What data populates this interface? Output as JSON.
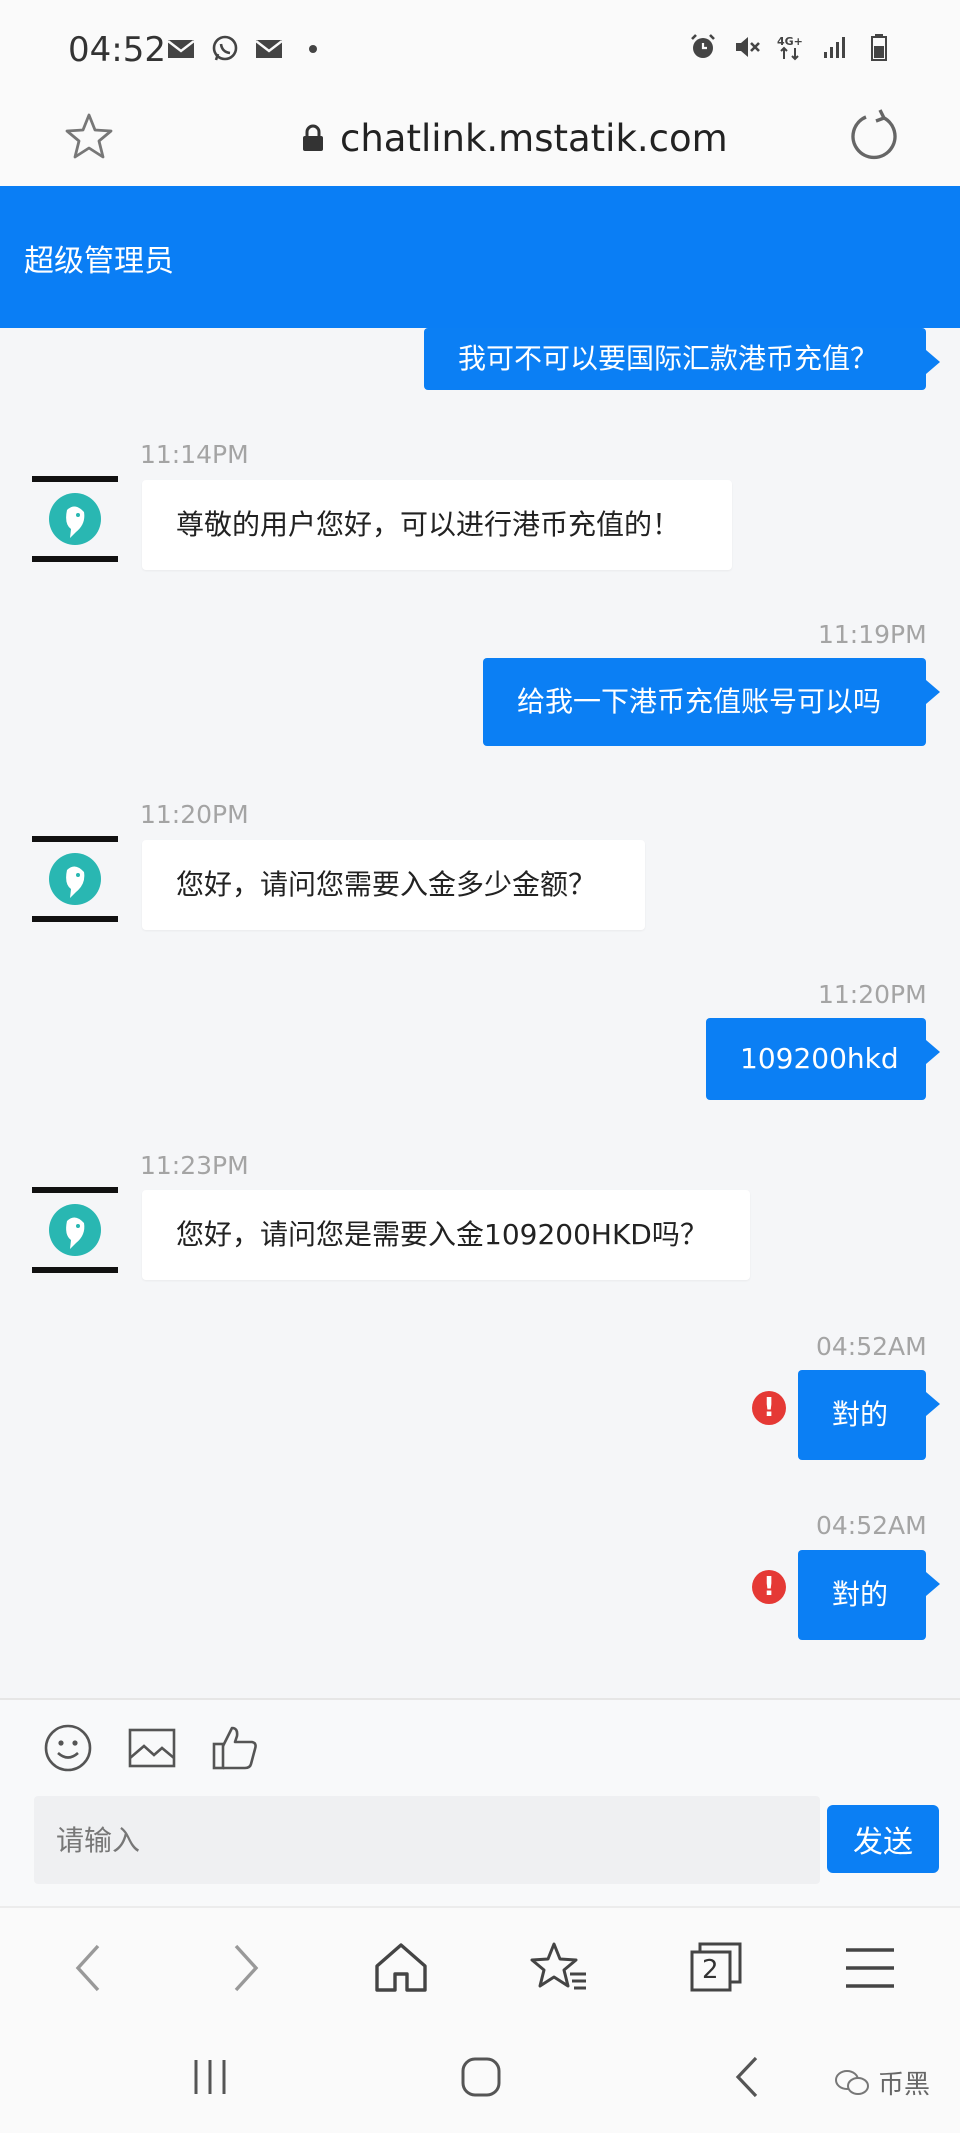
{
  "status_bar": {
    "time": "04:52",
    "left_icons": [
      "mail-icon",
      "whatsapp-icon",
      "mail-icon",
      "dot-icon"
    ],
    "right_icons": [
      "alarm-icon",
      "mute-icon",
      "4g-icon",
      "signal-icon",
      "battery-icon"
    ],
    "network_label": "4G+"
  },
  "browser": {
    "url": "chatlink.mstatik.com"
  },
  "chat": {
    "title": "超级管理员",
    "messages": [
      {
        "dir": "out",
        "text": "我可不可以要国际汇款港币充值？"
      },
      {
        "dir": "in",
        "time": "11:14PM",
        "text": "尊敬的用户您好，可以进行港币充值的！"
      },
      {
        "dir": "out",
        "time": "11:19PM",
        "text": "给我一下港币充值账号可以吗"
      },
      {
        "dir": "in",
        "time": "11:20PM",
        "text": "您好，请问您需要入金多少金额？"
      },
      {
        "dir": "out",
        "time": "11:20PM",
        "text": "109200hkd"
      },
      {
        "dir": "in",
        "time": "11:23PM",
        "text": "您好，请问您是需要入金109200HKD吗？"
      },
      {
        "dir": "out",
        "time": "04:52AM",
        "text": "對的",
        "error": "!"
      },
      {
        "dir": "out",
        "time": "04:52AM",
        "text": "對的",
        "error": "!"
      }
    ]
  },
  "composer": {
    "placeholder": "请输入",
    "send_label": "发送",
    "tools": [
      "emoji-icon",
      "image-icon",
      "thumbs-up-icon"
    ]
  },
  "browser_nav": {
    "tab_count": "2"
  },
  "watermark": "币黑",
  "colors": {
    "accent": "#0b7ff4",
    "error": "#e53935",
    "avatar_teal": "#29b7b2"
  }
}
